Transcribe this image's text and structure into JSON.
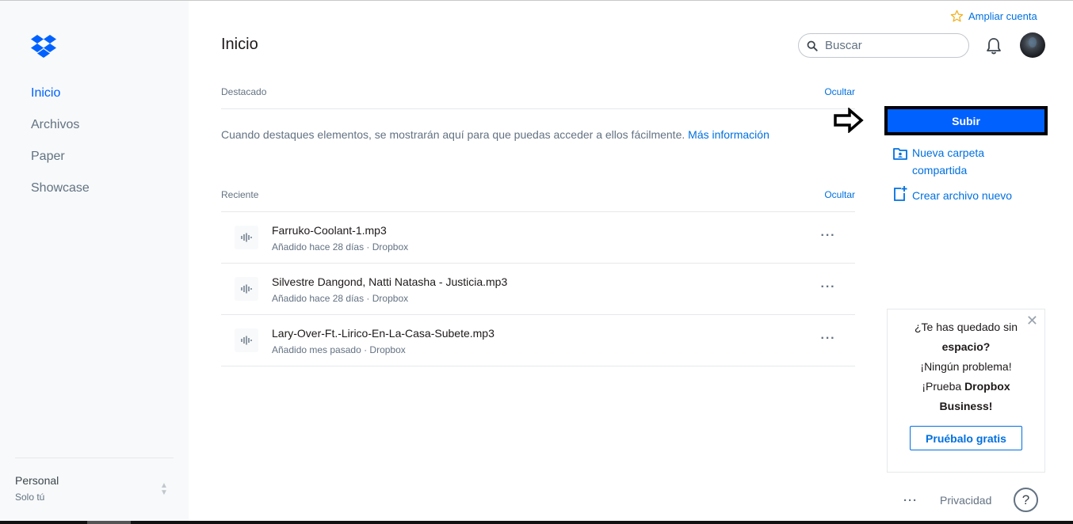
{
  "sidebar": {
    "logo": "dropbox-logo",
    "items": [
      {
        "label": "Inicio",
        "active": true
      },
      {
        "label": "Archivos",
        "active": false
      },
      {
        "label": "Paper",
        "active": false
      },
      {
        "label": "Showcase",
        "active": false
      }
    ],
    "account": {
      "name": "Personal",
      "sub": "Solo tú"
    }
  },
  "header": {
    "title": "Inicio",
    "upgrade_label": "Ampliar cuenta",
    "search_placeholder": "Buscar"
  },
  "starred": {
    "heading": "Destacado",
    "hide_label": "Ocultar",
    "empty_text": "Cuando destaques elementos, se mostrarán aquí para que puedas acceder a ellos fácilmente.",
    "more_link": "Más información"
  },
  "recent": {
    "heading": "Reciente",
    "hide_label": "Ocultar",
    "files": [
      {
        "name": "Farruko-Coolant-1.mp3",
        "meta": "Añadido hace 28 días · Dropbox"
      },
      {
        "name": "Silvestre Dangond, Natti Natasha - Justicia.mp3",
        "meta": "Añadido hace 28 días · Dropbox"
      },
      {
        "name": "Lary-Over-Ft.-Lirico-En-La-Casa-Subete.mp3",
        "meta": "Añadido mes pasado · Dropbox"
      }
    ],
    "more_glyph": "···"
  },
  "actions": {
    "upload_label": "Subir",
    "new_shared_folder": "Nueva carpeta compartida",
    "create_new_file": "Crear archivo nuevo"
  },
  "promo": {
    "line1": "¿Te has quedado sin",
    "line2": "espacio?",
    "line3": "¡Ningún problema!",
    "line4a": "¡Prueba ",
    "line4b": "Dropbox",
    "line5": "Business!",
    "button": "Pruébalo gratis",
    "close_glyph": "✕"
  },
  "footer": {
    "more_glyph": "···",
    "privacy": "Privacidad",
    "help": "?"
  },
  "colors": {
    "accent": "#0061fe",
    "link": "#0070e0",
    "sidebar_bg": "#f7f9fa"
  }
}
